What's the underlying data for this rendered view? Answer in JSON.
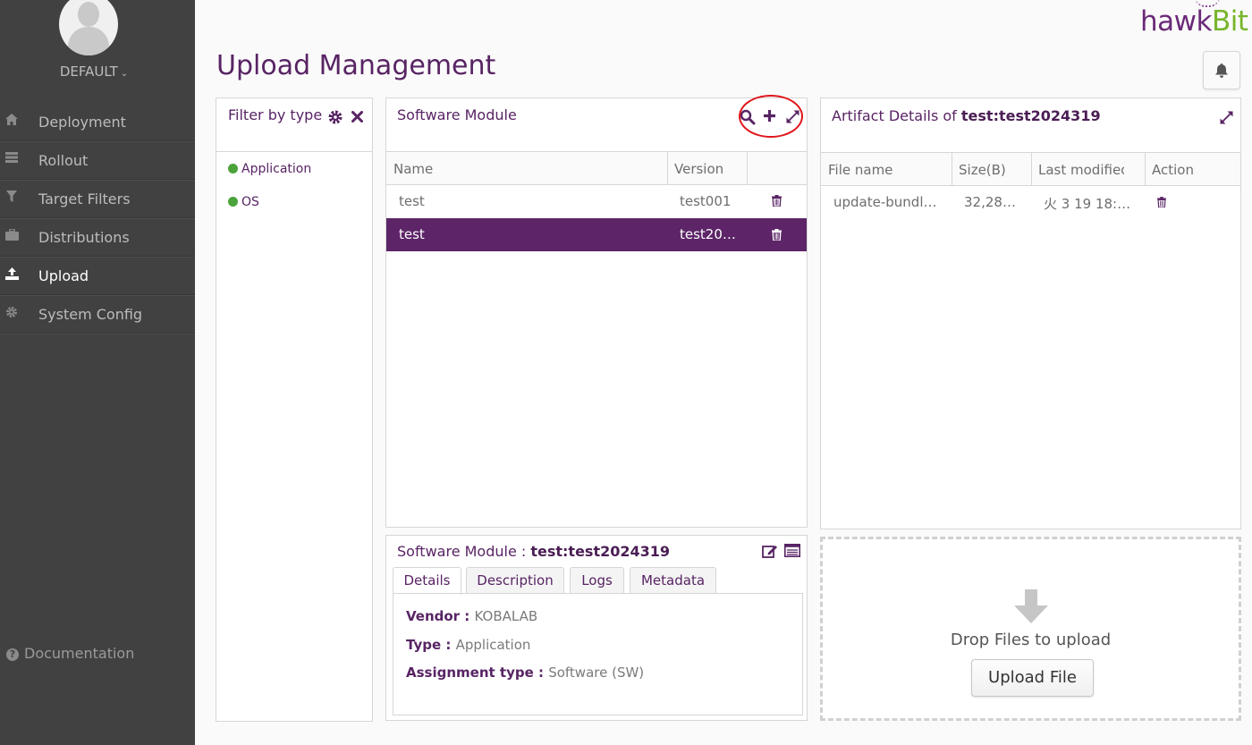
{
  "sidebar": {
    "tenant": "DEFAULT",
    "items": [
      {
        "label": "Deployment",
        "icon": "home-icon",
        "active": false
      },
      {
        "label": "Rollout",
        "icon": "list-icon",
        "active": false
      },
      {
        "label": "Target Filters",
        "icon": "filter-icon",
        "active": false
      },
      {
        "label": "Distributions",
        "icon": "briefcase-icon",
        "active": false
      },
      {
        "label": "Upload",
        "icon": "upload-icon",
        "active": true
      },
      {
        "label": "System Config",
        "icon": "gear-icon",
        "active": false
      }
    ],
    "documentation": "Documentation"
  },
  "header": {
    "title": "Upload Management",
    "logo_hawk": "hawk",
    "logo_bit": "Bit"
  },
  "filter": {
    "title": "Filter by type",
    "items": [
      {
        "label": "Application",
        "color": "#4aa33b"
      },
      {
        "label": "OS",
        "color": "#4aa33b"
      }
    ]
  },
  "software_module": {
    "title": "Software Module",
    "columns": [
      "Name",
      "Version"
    ],
    "rows": [
      {
        "name": "test",
        "version": "test001",
        "selected": false
      },
      {
        "name": "test",
        "version": "test20…",
        "selected": true
      }
    ]
  },
  "details": {
    "title_prefix": "Software Module : ",
    "title_value": "test:test2024319",
    "tabs": [
      "Details",
      "Description",
      "Logs",
      "Metadata"
    ],
    "active_tab": "Details",
    "fields": [
      {
        "key": "Vendor : ",
        "value": "KOBALAB"
      },
      {
        "key": "Type : ",
        "value": "Application"
      },
      {
        "key": "Assignment type : ",
        "value": "Software (SW)"
      }
    ]
  },
  "artifact": {
    "title_prefix": "Artifact Details of ",
    "title_value": "test:test2024319",
    "columns": [
      "File name",
      "Size(B)",
      "Last modifiec",
      "Action"
    ],
    "rows": [
      {
        "file": "update-bundl…",
        "size": "32,28…",
        "modified": "火 3 19 18:…"
      }
    ]
  },
  "upload": {
    "drop_text": "Drop Files to upload",
    "button": "Upload File"
  },
  "colors": {
    "brand": "#582464",
    "selected_row": "#5d2568",
    "sidebar": "#414141",
    "annotation": "#e0161b"
  }
}
